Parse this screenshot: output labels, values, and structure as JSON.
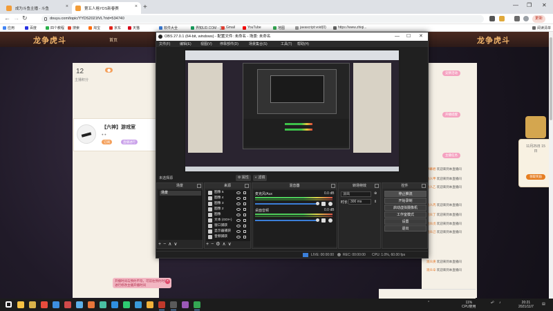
{
  "browser": {
    "tabs": [
      {
        "title": "成为斗鱼主播 - 斗鱼",
        "active": false,
        "color": "#f29c38"
      },
      {
        "title": "第五人格YDS新春赛",
        "active": true,
        "color": "#f29c38"
      }
    ],
    "address": "douyu.com/topic/YYDS2021fVL?rid=534740",
    "update_label": "更新",
    "bookmarks": [
      {
        "label": "应用",
        "color": "#4285f4"
      },
      {
        "label": "百度",
        "color": "#2932e1"
      },
      {
        "label": "四个教程",
        "color": "#2bb24c"
      },
      {
        "label": "搜索",
        "color": "#e2452c"
      },
      {
        "label": "淘宝",
        "color": "#ff6a00"
      },
      {
        "label": "京东",
        "color": "#e1251b"
      },
      {
        "label": "天猫",
        "color": "#d60017"
      },
      {
        "label": "软件大全",
        "color": "#3a7bd5"
      },
      {
        "label": "界知UD.COM - 正...",
        "color": "#17a05d"
      },
      {
        "label": "Gmail",
        "color": "#ea4335"
      },
      {
        "label": "YouTube",
        "color": "#ff0000"
      },
      {
        "label": "地图",
        "color": "#34a853"
      },
      {
        "label": "javascript:void(0)",
        "color": "#999999"
      },
      {
        "label": "https://www.zhiqi...",
        "color": "#666666"
      }
    ],
    "reading_list": "阅读清单"
  },
  "douyu": {
    "logo_left": "龙争虎斗",
    "logo_right": "龙争虎斗",
    "nav_link": "首页",
    "stat_number": "12",
    "stat_label": "主播积分",
    "card_title": "【六神】游戏室",
    "card_button_1": "订阅",
    "card_button_2": "直播进行",
    "right_chips": [
      "竞猜活动",
      "开播提醒",
      "主播任务"
    ],
    "chat": [
      {
        "user": "弹幕君",
        "text": "欢迎来到本直播间"
      },
      {
        "user": "路人甲",
        "text": "欢迎来到本直播间"
      },
      {
        "user": "路人乙",
        "text": "欢迎来到本直播间"
      },
      {
        "user": "路人丙",
        "text": "欢迎来到本直播间"
      },
      {
        "user": "观众丁",
        "text": "欢迎来到本直播间"
      },
      {
        "user": "观众戊",
        "text": "欢迎来到本直播间"
      },
      {
        "user": "观众己",
        "text": "欢迎来到本直播间"
      },
      {
        "user": "观众庚",
        "text": "欢迎来到本直播间"
      },
      {
        "user": "观众辛",
        "text": "欢迎来到本直播间"
      }
    ],
    "side_pop_text": "11月25日 15日",
    "side_pop_button": "领取奖励",
    "pink_note": "开播时间与预约不符，可前往预约时间进行修改主播开播时间"
  },
  "obs": {
    "title": "OBS 27.0.1 (64-bit, windows) - 配置文件: 未命名 - 场景: 未命名",
    "menu": [
      "文件(F)",
      "编辑(E)",
      "视图(V)",
      "停靠部件(D)",
      "场景集合(S)",
      "工具(T)",
      "帮助(H)"
    ],
    "no_source_label": "未选择源",
    "props_button": "属性",
    "filters_button": "滤镜",
    "docks": {
      "scenes": "场景",
      "sources": "来源",
      "mixer": "混音器",
      "transitions": "转场特效",
      "controls": "控件"
    },
    "scene_items": [
      "场景"
    ],
    "sources": [
      {
        "name": "图像 5",
        "icon": "image-icon"
      },
      {
        "name": "图像 4",
        "icon": "image-icon"
      },
      {
        "name": "图像 3",
        "icon": "image-icon"
      },
      {
        "name": "图像 2",
        "icon": "image-icon"
      },
      {
        "name": "图像",
        "icon": "image-icon"
      },
      {
        "name": "文本 (GDI+)",
        "icon": "text-icon"
      },
      {
        "name": "窗口捕获",
        "icon": "window-icon"
      },
      {
        "name": "显示器捕获",
        "icon": "monitor-icon"
      },
      {
        "name": "音频捕获",
        "icon": "audio-icon"
      }
    ],
    "mixer": [
      {
        "name": "麦克风/Aux",
        "db": "0.0 dB"
      },
      {
        "name": "桌面音频",
        "db": "0.0 dB"
      }
    ],
    "transitions": {
      "type": "淡出",
      "duration_label": "时长",
      "duration_value": "300 ms"
    },
    "controls": [
      "停止推流",
      "开始录制",
      "启动虚拟摄像机",
      "工作室模式",
      "设置",
      "退出"
    ],
    "status": {
      "live": "LIVE: 00:00:00",
      "rec": "REC: 00:00:00",
      "cpu": "CPU: 1.0%, 60.00 fps"
    }
  },
  "taskbar": {
    "apps": [
      {
        "name": "start-icon",
        "color": "#ffffff"
      },
      {
        "name": "file-explorer-icon",
        "color": "#f6c244"
      },
      {
        "name": "app-icon-2",
        "color": "#d9b44a"
      },
      {
        "name": "app-icon-3",
        "color": "#e84c3d"
      },
      {
        "name": "app-icon-4",
        "color": "#3d8fe0"
      },
      {
        "name": "app-icon-5",
        "color": "#d04a4a"
      },
      {
        "name": "app-icon-6",
        "color": "#5db0e8"
      },
      {
        "name": "app-icon-7",
        "color": "#e8763a"
      },
      {
        "name": "app-icon-8",
        "color": "#49c0a2"
      },
      {
        "name": "edge-icon",
        "color": "#2f8fe0"
      },
      {
        "name": "app-icon-10",
        "color": "#2ecc71"
      },
      {
        "name": "app-icon-11",
        "color": "#3a9bd9"
      },
      {
        "name": "app-icon-12",
        "color": "#f0b23a"
      },
      {
        "name": "app-icon-13",
        "color": "#c0392b"
      },
      {
        "name": "obs-icon",
        "color": "#5a5a5a"
      },
      {
        "name": "app-icon-15",
        "color": "#9b59b6"
      },
      {
        "name": "chrome-icon",
        "color": "#34a853"
      }
    ],
    "cpu_percent": "11%",
    "cpu_label": "CPU使用",
    "time": "20:21",
    "date": "2021/11/7"
  }
}
